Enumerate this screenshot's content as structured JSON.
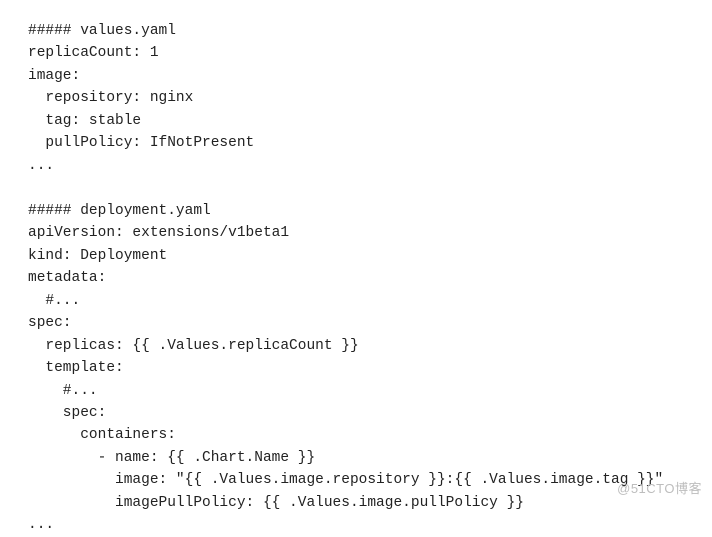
{
  "code": {
    "lines": [
      "##### values.yaml",
      "replicaCount: 1",
      "image:",
      "  repository: nginx",
      "  tag: stable",
      "  pullPolicy: IfNotPresent",
      "...",
      "",
      "##### deployment.yaml",
      "apiVersion: extensions/v1beta1",
      "kind: Deployment",
      "metadata:",
      "  #...",
      "spec:",
      "  replicas: {{ .Values.replicaCount }}",
      "  template:",
      "    #...",
      "    spec:",
      "      containers:",
      "        - name: {{ .Chart.Name }}",
      "          image: \"{{ .Values.image.repository }}:{{ .Values.image.tag }}\"",
      "          imagePullPolicy: {{ .Values.image.pullPolicy }}",
      "..."
    ]
  },
  "watermark": "@51CTO博客"
}
